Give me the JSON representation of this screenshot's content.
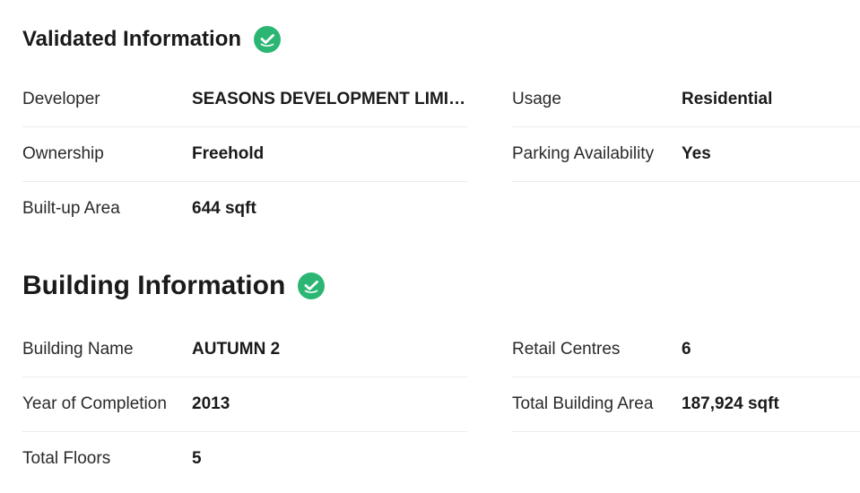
{
  "validated": {
    "title": "Validated Information",
    "icon": "verified-check-icon",
    "left_rows": [
      {
        "label": "Developer",
        "value": "SEASONS DEVELOPMENT LIMITED"
      },
      {
        "label": "Ownership",
        "value": "Freehold"
      },
      {
        "label": "Built-up Area",
        "value": "644 sqft"
      }
    ],
    "right_rows": [
      {
        "label": "Usage",
        "value": "Residential"
      },
      {
        "label": "Parking Availability",
        "value": "Yes"
      }
    ]
  },
  "building": {
    "title": "Building Information",
    "icon": "verified-check-icon",
    "left_rows": [
      {
        "label": "Building Name",
        "value": "AUTUMN 2"
      },
      {
        "label": "Year of Completion",
        "value": "2013"
      },
      {
        "label": "Total Floors",
        "value": "5"
      }
    ],
    "right_rows": [
      {
        "label": "Retail Centres",
        "value": "6"
      },
      {
        "label": "Total Building Area",
        "value": "187,924 sqft"
      }
    ]
  },
  "colors": {
    "check": "#2bb673",
    "divider": "#ececec"
  }
}
